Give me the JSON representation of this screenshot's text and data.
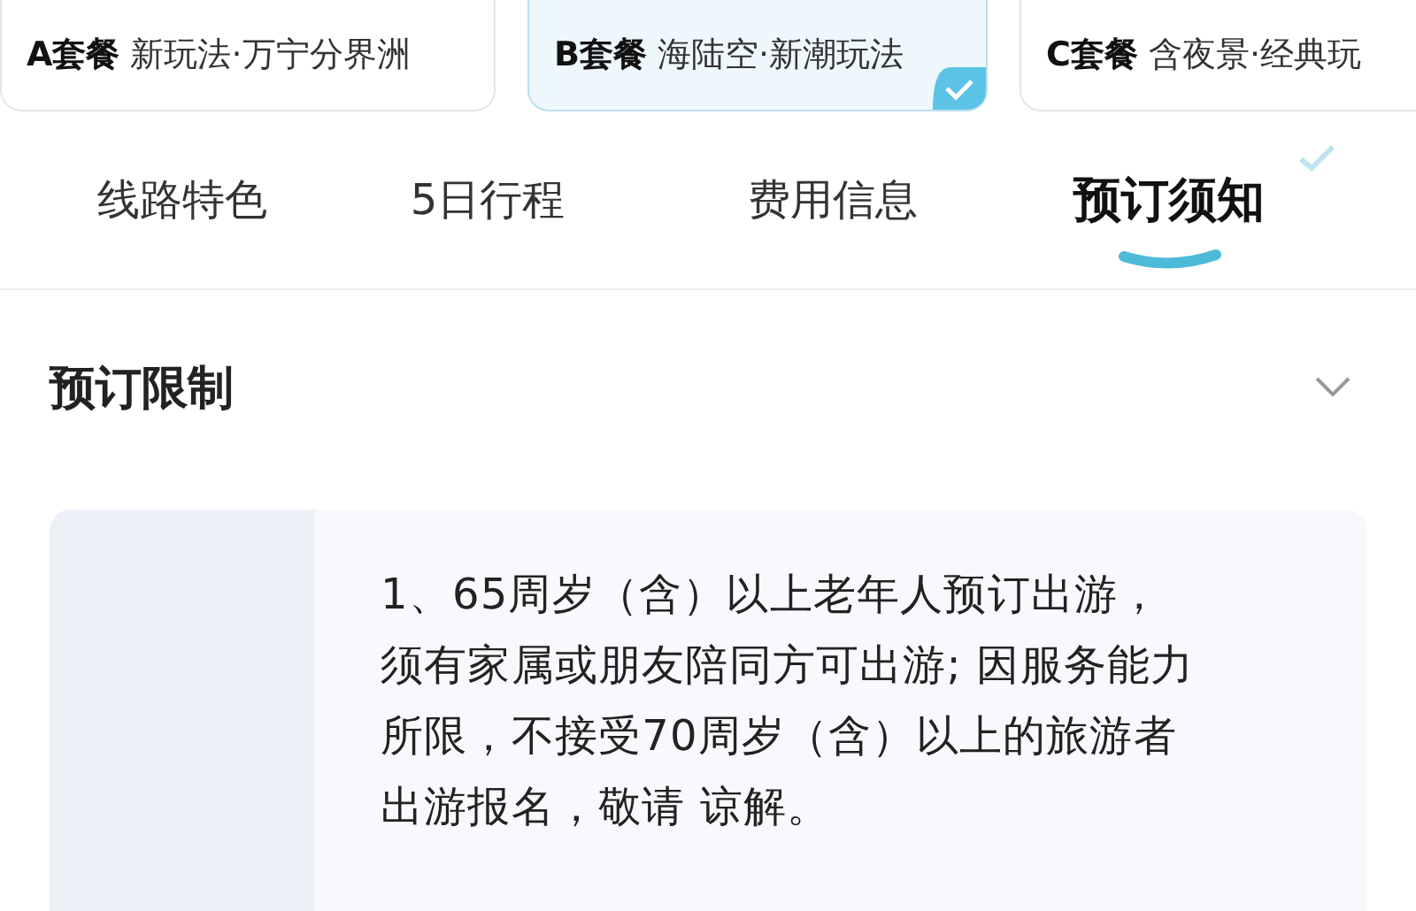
{
  "packages": [
    {
      "code": "A套餐",
      "name": "新玩法·万宁分界洲",
      "selected": false
    },
    {
      "code": "B套餐",
      "name": "海陆空·新潮玩法",
      "selected": true
    },
    {
      "code": "C套餐",
      "name": "含夜景·经典玩",
      "selected": false
    }
  ],
  "tabs": [
    {
      "label": "线路特色",
      "selected": false
    },
    {
      "label": "5日行程",
      "selected": false
    },
    {
      "label": "费用信息",
      "selected": false
    },
    {
      "label": "预订须知",
      "selected": true
    }
  ],
  "section": {
    "title": "预订限制",
    "expanded": true,
    "notice": "1、65周岁（含）以上老年人预订出游，须有家属或朋友陪同方可出游; 因服务能力所限，不接受70周岁（含）以上的旅游者出游报名，敬请 谅解。"
  }
}
